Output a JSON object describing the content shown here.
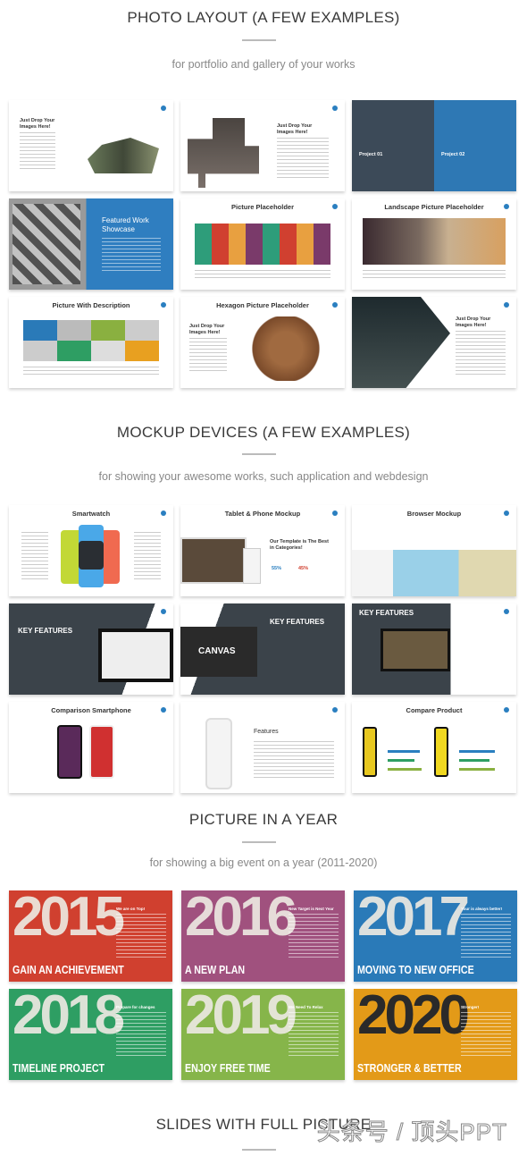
{
  "sections": [
    {
      "title": "PHOTO LAYOUT (A FEW EXAMPLES)",
      "subtitle": "for portfolio and gallery of your works",
      "slides": [
        {
          "title": "",
          "text": "Just Drop Your Images Here!"
        },
        {
          "title": "",
          "text": "Just Drop Your Images Here!"
        },
        {
          "title": "",
          "text": "Project 01",
          "text2": "Project 02"
        },
        {
          "title": "Featured Work Showcase"
        },
        {
          "title": "Picture Placeholder"
        },
        {
          "title": "Landscape Picture Placeholder"
        },
        {
          "title": "Picture With Description"
        },
        {
          "title": "Hexagon Picture Placeholder",
          "text": "Just Drop Your Images Here!"
        },
        {
          "title": "",
          "text": "Just Drop Your Images Here!"
        }
      ]
    },
    {
      "title": "MOCKUP DEVICES (A FEW EXAMPLES)",
      "subtitle": "for showing your awesome works, such application and webdesign",
      "slides": [
        {
          "title": "Smartwatch"
        },
        {
          "title": "Tablet & Phone Mockup",
          "text": "Our Template is The Best in Categories!",
          "stat1": "55%",
          "stat2": "45%"
        },
        {
          "title": "Browser Mockup"
        },
        {
          "title": "KEY FEATURES"
        },
        {
          "title": "KEY FEATURES",
          "text": "CANVAS"
        },
        {
          "title": "KEY FEATURES"
        },
        {
          "title": "Comparison Smartphone"
        },
        {
          "title": "Features"
        },
        {
          "title": "Compare Product"
        }
      ]
    },
    {
      "title": "PICTURE IN A YEAR",
      "subtitle": "for showing a big event on a year (2011-2020)",
      "years": [
        {
          "year": "2015",
          "caption": "GAIN AN ACHIEVEMENT",
          "heading": "We are on Top!",
          "color": "#d0402f"
        },
        {
          "year": "2016",
          "caption": "A NEW PLAN",
          "heading": "New Target is Next Year",
          "color": "#a0517e"
        },
        {
          "year": "2017",
          "caption": "MOVING TO NEW OFFICE",
          "heading": "Your is always better!",
          "color": "#2a7ab8"
        },
        {
          "year": "2018",
          "caption": "TIMELINE PROJECT",
          "heading": "Prepare for changes",
          "color": "#2e9e63"
        },
        {
          "year": "2019",
          "caption": "ENJOY FREE TIME",
          "heading": "We Need To Relax",
          "color": "#86b54a"
        },
        {
          "year": "2020",
          "caption": "STRONGER & BETTER",
          "heading": "Stronger!",
          "color": "#e39a18"
        }
      ]
    },
    {
      "title": "SLIDES WITH FULL PICTURE"
    }
  ],
  "watermark": "头条号 / 顶头PPT",
  "colors": {
    "accent": "#2a7fc0",
    "dark_slide": "#3b434a"
  }
}
